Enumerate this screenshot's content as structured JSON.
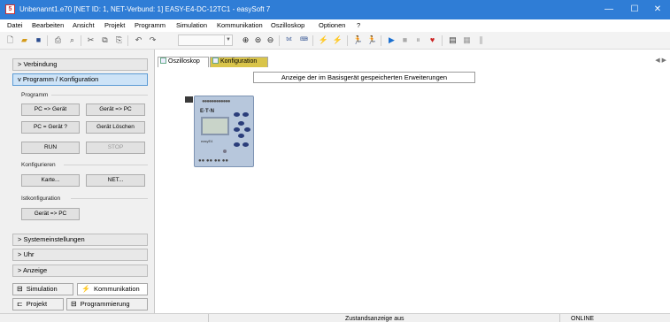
{
  "window": {
    "title": "Unbenannt1.e70 [NET ID: 1, NET-Verbund: 1] EASY-E4-DC-12TC1 - easySoft 7",
    "controls": [
      "—",
      "☐",
      "✕"
    ]
  },
  "menu": [
    "Datei",
    "Bearbeiten",
    "Ansicht",
    "Projekt",
    "Programm",
    "Simulation",
    "Kommunikation",
    "Oszilloskop",
    "Optionen",
    "?"
  ],
  "toolbar": {
    "icons": [
      "new-icon",
      "open-icon",
      "save-icon",
      "print-icon",
      "print-preview-icon",
      "cut-icon",
      "copy-icon",
      "paste-icon",
      "undo-icon",
      "redo-icon",
      "zoom-in-icon",
      "zoom-reset-icon",
      "zoom-out-icon",
      "text-icon",
      "key-icon",
      "connect-icon",
      "disconnect-icon",
      "run-green-icon",
      "run-gray-icon",
      "play-icon",
      "stop-icon",
      "pause-icon",
      "trace-icon",
      "report-icon",
      "grid-icon",
      "columns-icon"
    ],
    "zoom_value": ""
  },
  "sidebar": {
    "verbindung": "> Verbindung",
    "programm_konfig": "v Programm / Konfiguration",
    "group_programm": "Programm",
    "btn_pc_geraet": "PC => Gerät",
    "btn_geraet_pc": "Gerät => PC",
    "btn_pc_eq_geraet": "PC = Gerät ?",
    "btn_geraet_loeschen": "Gerät Löschen",
    "btn_run": "RUN",
    "btn_stop": "STOP",
    "group_konfigurieren": "Konfigurieren",
    "btn_karte": "Karte...",
    "btn_net": "NET...",
    "group_istkonfiguration": "Istkonfiguration",
    "btn_ist_geraet_pc": "Gerät => PC",
    "systemeinstellungen": "> Systemeinstellungen",
    "uhr": "> Uhr",
    "anzeige": "> Anzeige"
  },
  "panel_tabs": {
    "simulation": "Simulation",
    "kommunikation": "Kommunikation",
    "projekt": "Projekt",
    "programmierung": "Programmierung"
  },
  "doc_tabs": {
    "oszilloskop": "Oszilloskop",
    "konfiguration": "Konfiguration",
    "nav": "◀ ▶"
  },
  "canvas": {
    "info": "Anzeige der im Basisgerät gespeicherten Erweiterungen",
    "device_logo": "E·T·N",
    "device_label": "easyE4",
    "device_terminals_top": "●●●●●●●●●●●●",
    "device_terminals_bottom": "●● ●● ●● ●●"
  },
  "status": {
    "center": "Zustandsanzeige aus",
    "right": "ONLINE"
  },
  "colors": {
    "titlebar": "#2f7dd6",
    "active_accordion": "#cde3f7",
    "konfiguration_tab": "#d9c44a",
    "device_body": "#b7c7dc"
  }
}
